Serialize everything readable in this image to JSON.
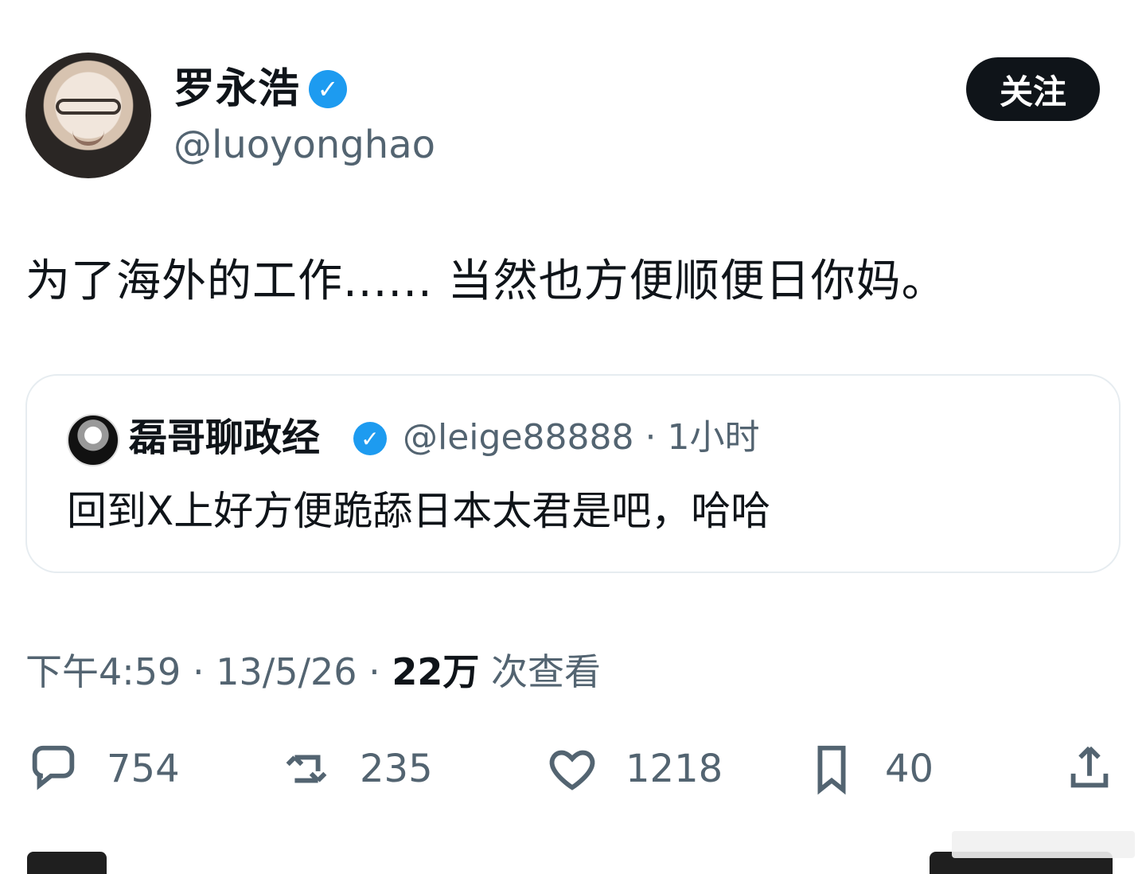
{
  "tweet": {
    "author": {
      "name": "罗永浩",
      "handle": "@luoyonghao",
      "verified": true
    },
    "follow_label": "关注",
    "text": "为了海外的工作...... 当然也方便顺便日你妈。",
    "quote": {
      "name": "磊哥聊政经",
      "handle": "@leige88888",
      "time": "1小时",
      "verified": true,
      "text": "回到X上好方便跪舔日本太君是吧，哈哈"
    },
    "meta": {
      "time": "下午4:59",
      "date": "13/5/26",
      "views": "22万",
      "views_label": "次查看"
    },
    "actions": {
      "replies": "754",
      "reposts": "235",
      "likes": "1218",
      "bookmarks": "40"
    }
  },
  "colors": {
    "accent": "#1d9bf0",
    "text": "#0f1419",
    "muted": "#536471",
    "border": "#e6ecf0"
  },
  "icons": [
    "verified-icon",
    "comment-icon",
    "retweet-icon",
    "heart-icon",
    "bookmark-icon",
    "share-icon"
  ]
}
